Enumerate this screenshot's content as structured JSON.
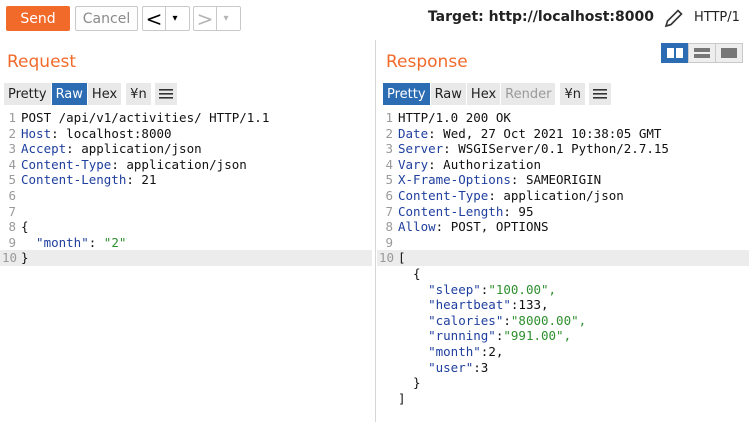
{
  "toolbar": {
    "send_label": "Send",
    "cancel_label": "Cancel",
    "back_arrow": "<",
    "forward_arrow": ">",
    "dropdown": "▾",
    "target_label": "Target: http://localhost:8000",
    "http_label": "HTTP/1"
  },
  "request": {
    "title": "Request",
    "tabs": [
      "Pretty",
      "Raw",
      "Hex",
      "¥n"
    ],
    "active_tab": "Raw",
    "lines": [
      {
        "n": "1",
        "key": "",
        "sep": "",
        "val": "POST /api/v1/activities/ HTTP/1.1"
      },
      {
        "n": "2",
        "key": "Host",
        "sep": ": ",
        "val": "localhost:8000"
      },
      {
        "n": "3",
        "key": "Accept",
        "sep": ": ",
        "val": "application/json"
      },
      {
        "n": "4",
        "key": "Content-Type",
        "sep": ": ",
        "val": "application/json"
      },
      {
        "n": "5",
        "key": "Content-Length",
        "sep": ": ",
        "val": "21"
      },
      {
        "n": "6",
        "key": "",
        "sep": "",
        "val": ""
      },
      {
        "n": "7",
        "key": "",
        "sep": "",
        "val": ""
      },
      {
        "n": "8",
        "key": "",
        "sep": "",
        "val": "{"
      },
      {
        "n": "9",
        "key": "  \"month\"",
        "sep": ": ",
        "val": "\"2\""
      },
      {
        "n": "10",
        "key": "",
        "sep": "",
        "val": "}"
      }
    ]
  },
  "response": {
    "title": "Response",
    "tabs": [
      "Pretty",
      "Raw",
      "Hex",
      "Render",
      "¥n"
    ],
    "active_tab": "Pretty",
    "disabled_tab": "Render",
    "lines": [
      {
        "n": "1",
        "key": "",
        "sep": "",
        "val": "HTTP/1.0 200 OK"
      },
      {
        "n": "2",
        "key": "Date",
        "sep": ": ",
        "val": "Wed, 27 Oct 2021 10:38:05 GMT"
      },
      {
        "n": "3",
        "key": "Server",
        "sep": ": ",
        "val": "WSGIServer/0.1 Python/2.7.15"
      },
      {
        "n": "4",
        "key": "Vary",
        "sep": ": ",
        "val": "Authorization"
      },
      {
        "n": "5",
        "key": "X-Frame-Options",
        "sep": ": ",
        "val": "SAMEORIGIN"
      },
      {
        "n": "6",
        "key": "Content-Type",
        "sep": ": ",
        "val": "application/json"
      },
      {
        "n": "7",
        "key": "Content-Length",
        "sep": ": ",
        "val": "95"
      },
      {
        "n": "8",
        "key": "Allow",
        "sep": ": ",
        "val": "POST, OPTIONS"
      },
      {
        "n": "9",
        "key": "",
        "sep": "",
        "val": ""
      },
      {
        "n": "10",
        "key": "",
        "sep": "",
        "val": "["
      },
      {
        "n": "",
        "key": "",
        "sep": "",
        "val": "  {"
      },
      {
        "n": "",
        "key": "    \"sleep\"",
        "sep": ":",
        "val": "\"100.00\","
      },
      {
        "n": "",
        "key": "    \"heartbeat\"",
        "sep": ":",
        "val": "133,"
      },
      {
        "n": "",
        "key": "    \"calories\"",
        "sep": ":",
        "val": "\"8000.00\","
      },
      {
        "n": "",
        "key": "    \"running\"",
        "sep": ":",
        "val": "\"991.00\","
      },
      {
        "n": "",
        "key": "    \"month\"",
        "sep": ":",
        "val": "2,"
      },
      {
        "n": "",
        "key": "    \"user\"",
        "sep": ":",
        "val": "3"
      },
      {
        "n": "",
        "key": "",
        "sep": "",
        "val": "  }"
      },
      {
        "n": "",
        "key": "",
        "sep": "",
        "val": "]"
      }
    ]
  },
  "colors": {
    "accent": "#f26a2a",
    "active_tab": "#2b6cb3",
    "header_key": "#1f3f9e",
    "string_value": "#2f8f2f"
  },
  "icons": [
    "pencil-icon",
    "layout-split-icon",
    "layout-horizontal-icon",
    "layout-single-icon",
    "menu-icon"
  ]
}
